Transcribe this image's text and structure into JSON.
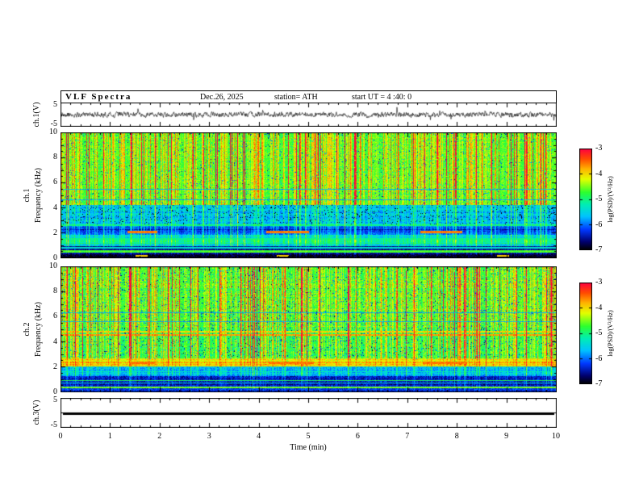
{
  "header": {
    "title": "VLF Spectra",
    "date": "Dec.26, 2025",
    "station": "station= ATH",
    "start_ut": "start UT =  4 :40: 0"
  },
  "xaxis": {
    "label": "Time (min)",
    "ticks": [
      "0",
      "1",
      "2",
      "3",
      "4",
      "5",
      "6",
      "7",
      "8",
      "9",
      "10"
    ]
  },
  "panels": {
    "ch1_wave": {
      "ylabel": "ch.1(V)",
      "ymax": "5",
      "ymin": "-5"
    },
    "ch1_spec": {
      "ylabel_line1": "ch.1",
      "ylabel_line2": "Frequency (kHz)",
      "yticks": [
        "10",
        "8",
        "6",
        "4",
        "2",
        "0"
      ]
    },
    "ch2_spec": {
      "ylabel_line1": "ch.2",
      "ylabel_line2": "Frequency (kHz)",
      "yticks": [
        "10",
        "8",
        "6",
        "4",
        "2",
        "0"
      ]
    },
    "ch3_wave": {
      "ylabel": "ch.3(V)",
      "ymax": "5",
      "ymin": "-5"
    }
  },
  "colorbar": {
    "label": "log(PSD)/(V²/Hz)",
    "ticks": [
      "-3",
      "-4",
      "-5",
      "-6",
      "-7"
    ]
  },
  "colormap": [
    {
      "t": 0.0,
      "color": "#000000"
    },
    {
      "t": 0.08,
      "color": "#00006e"
    },
    {
      "t": 0.2,
      "color": "#0038ff"
    },
    {
      "t": 0.33,
      "color": "#00c3ff"
    },
    {
      "t": 0.45,
      "color": "#00eeb4"
    },
    {
      "t": 0.57,
      "color": "#2dff2d"
    },
    {
      "t": 0.7,
      "color": "#e4ff00"
    },
    {
      "t": 0.8,
      "color": "#ffb400"
    },
    {
      "t": 0.9,
      "color": "#ff4b00"
    },
    {
      "t": 1.0,
      "color": "#ff0040"
    }
  ],
  "chart_data": [
    {
      "id": "ch1_waveform",
      "type": "line",
      "title": "ch.1 time series",
      "ylabel": "ch.1(V)",
      "ylim": [
        -5,
        5
      ],
      "xlim": [
        0,
        10
      ],
      "xlabel": "Time (min)",
      "summary": "continuous broadband noise trace centered on 0 V, typical excursions about ±1.5 V with sporadic impulsive spikes",
      "seed": 19
    },
    {
      "id": "ch1_spectrogram",
      "type": "heatmap",
      "title": "ch.1 VLF spectrogram",
      "ylabel": "Frequency (kHz)",
      "ylim": [
        0,
        10
      ],
      "xlim": [
        0,
        10
      ],
      "zlim": [
        -7,
        -3
      ],
      "zlabel": "log(PSD)/(V²/Hz)",
      "seed": 1226,
      "noise": 0.5,
      "blue_speckle": 0.05,
      "bands": [
        [
          4.2,
          10.01,
          -4.75
        ],
        [
          2.6,
          4.2,
          -5.7
        ],
        [
          1.85,
          2.6,
          -6.3
        ],
        [
          0.95,
          1.85,
          -5.5
        ],
        [
          0.3,
          0.95,
          -6.65
        ],
        [
          0,
          0.3,
          -6.9
        ]
      ],
      "lines": [
        [
          0.52,
          -4.7,
          0.07
        ],
        [
          0.8,
          -5.4,
          0.05
        ],
        [
          1.15,
          -5.0,
          0.05
        ],
        [
          1.5,
          -5.15,
          0.05
        ],
        [
          2.62,
          -5.1,
          0.04
        ],
        [
          4.65,
          -5.9,
          0.05
        ],
        [
          5.5,
          -5.85,
          0.04
        ]
      ],
      "segments": [
        [
          2.05,
          -3.6,
          0.09,
          [
            [
              1.35,
              1.95
            ],
            [
              4.15,
              5.0
            ],
            [
              7.25,
              8.1
            ]
          ]
        ],
        [
          0.15,
          -3.9,
          0.06,
          [
            [
              1.5,
              1.75
            ],
            [
              4.35,
              4.6
            ],
            [
              8.8,
              9.05
            ]
          ]
        ]
      ],
      "streak_gain": [
        [
          4.2,
          1.0
        ],
        [
          2.6,
          0.6
        ],
        [
          0.95,
          0.55
        ],
        [
          0.3,
          0.2
        ],
        [
          0,
          0.08
        ]
      ],
      "row_noise": [
        [
          0.95,
          4.2,
          0.3
        ]
      ]
    },
    {
      "id": "ch2_spectrogram",
      "type": "heatmap",
      "title": "ch.2 VLF spectrogram",
      "ylabel": "Frequency (kHz)",
      "ylim": [
        0,
        10
      ],
      "xlim": [
        0,
        10
      ],
      "zlim": [
        -7,
        -3
      ],
      "zlabel": "log(PSD)/(V²/Hz)",
      "seed": 4040,
      "noise": 0.55,
      "blue_speckle": 0.07,
      "bands": [
        [
          5.2,
          10.01,
          -4.8
        ],
        [
          2.65,
          5.2,
          -4.95
        ],
        [
          2.0,
          2.65,
          -4.1
        ],
        [
          1.25,
          2.0,
          -5.85
        ],
        [
          0.5,
          1.25,
          -6.55
        ],
        [
          0,
          0.5,
          -6.35
        ]
      ],
      "lines": [
        [
          4.55,
          -3.85,
          0.06
        ],
        [
          4.82,
          -4.1,
          0.05
        ],
        [
          5.6,
          -5.9,
          0.04
        ],
        [
          6.3,
          -5.95,
          0.04
        ],
        [
          1.6,
          -5.3,
          0.05
        ],
        [
          0.9,
          -4.9,
          0.06
        ],
        [
          0.7,
          -5.6,
          0.04
        ],
        [
          0.33,
          -4.55,
          0.07
        ]
      ],
      "segments": [
        [
          2.32,
          -3.55,
          0.08,
          [
            [
              1.4,
              1.9
            ],
            [
              4.2,
              5.1
            ],
            [
              7.3,
              8.2
            ]
          ]
        ]
      ],
      "streak_gain": [
        [
          2.65,
          1.0
        ],
        [
          2.0,
          0.35
        ],
        [
          1.25,
          0.5
        ],
        [
          0.5,
          0.25
        ],
        [
          0,
          0.15
        ]
      ],
      "row_noise": [
        [
          1.25,
          2.65,
          0.25
        ],
        [
          5.2,
          10,
          0.15
        ]
      ]
    },
    {
      "id": "ch3_waveform",
      "type": "line",
      "title": "ch.3 time series",
      "ylabel": "ch.3(V)",
      "ylim": [
        -5,
        5
      ],
      "xlim": [
        0,
        10
      ],
      "xlabel": "Time (min)",
      "summary": "flat thick line at 0 V for the whole interval (no signal)",
      "value": 0
    }
  ]
}
